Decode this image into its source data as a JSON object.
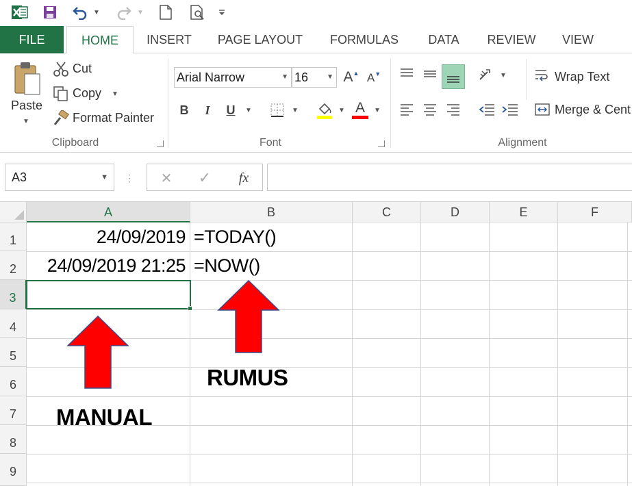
{
  "qat": {
    "excel_icon": "excel-logo-icon",
    "save_icon": "save-icon",
    "undo_icon": "undo-icon",
    "redo_icon": "redo-icon",
    "new_icon": "new-document-icon",
    "preview_icon": "print-preview-icon",
    "customize_icon": "customize-qat-icon"
  },
  "tabs": [
    "FILE",
    "HOME",
    "INSERT",
    "PAGE LAYOUT",
    "FORMULAS",
    "DATA",
    "REVIEW",
    "VIEW"
  ],
  "clipboard": {
    "paste": "Paste",
    "cut": "Cut",
    "copy": "Copy",
    "format_painter": "Format Painter",
    "group": "Clipboard"
  },
  "font": {
    "name": "Arial Narrow",
    "size": "16",
    "bold": "B",
    "italic": "I",
    "underline": "U",
    "font_color_letter": "A",
    "grow": "A",
    "shrink": "A",
    "group": "Font",
    "fill_color": "#ffff00",
    "font_color": "#ff0000"
  },
  "alignment": {
    "wrap_text": "Wrap Text",
    "merge_center": "Merge & Cent",
    "group": "Alignment"
  },
  "formula_bar": {
    "name_box": "A3",
    "cancel": "✕",
    "enter": "✓",
    "fx": "fx",
    "value": ""
  },
  "sheet": {
    "columns": [
      "A",
      "B",
      "C",
      "D",
      "E",
      "F"
    ],
    "rows": [
      "1",
      "2",
      "3",
      "4",
      "5",
      "6",
      "7",
      "8",
      "9"
    ],
    "active_column": "A",
    "active_row": "3",
    "cells": {
      "A1": "24/09/2019",
      "B1": "=TODAY()",
      "A2": "24/09/2019 21:25",
      "B2": "=NOW()"
    }
  },
  "annotations": {
    "left_label": "MANUAL",
    "right_label": "RUMUS",
    "arrow_color": "#ff0000",
    "arrow_stroke": "#3a4a8a"
  },
  "colors": {
    "accent": "#217346"
  }
}
